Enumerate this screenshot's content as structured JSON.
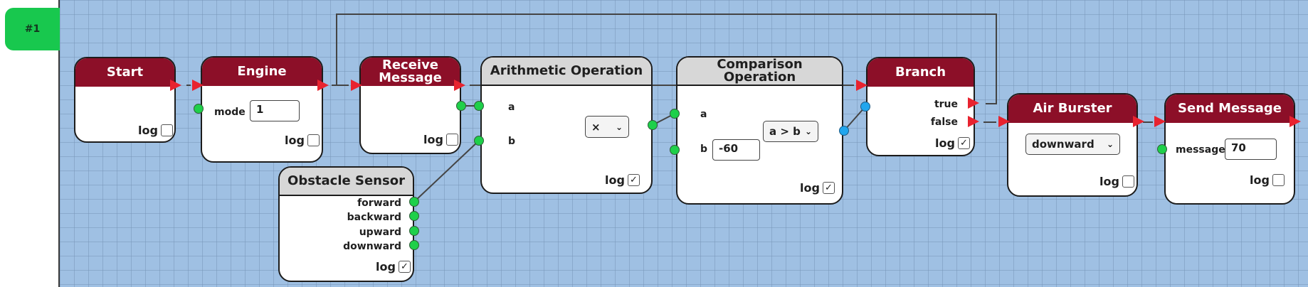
{
  "sidebar": {
    "tab_label": "#1"
  },
  "nodes": {
    "start": {
      "title": "Start",
      "log_label": "log",
      "log_checked": ""
    },
    "engine": {
      "title": "Engine",
      "mode_label": "mode",
      "mode_value": "1",
      "log_label": "log",
      "log_checked": ""
    },
    "receive": {
      "title_line1": "Receive",
      "title_line2": "Message",
      "log_label": "log",
      "log_checked": ""
    },
    "sensor": {
      "title": "Obstacle Sensor",
      "outputs": [
        "forward",
        "backward",
        "upward",
        "downward"
      ],
      "log_label": "log",
      "log_checked": "✓"
    },
    "arith": {
      "title": "Arithmetic Operation",
      "a_label": "a",
      "b_label": "b",
      "operator": "×",
      "log_label": "log",
      "log_checked": "✓"
    },
    "compare": {
      "title_line1": "Comparison",
      "title_line2": "Operation",
      "a_label": "a",
      "b_label": "b",
      "b_value": "-60",
      "operator": "a > b",
      "log_label": "log",
      "log_checked": "✓"
    },
    "branch": {
      "title": "Branch",
      "true_label": "true",
      "false_label": "false",
      "log_label": "log",
      "log_checked": "✓"
    },
    "burster": {
      "title": "Air Burster",
      "direction": "downward",
      "log_label": "log",
      "log_checked": ""
    },
    "send": {
      "title": "Send Message",
      "message_label": "message",
      "message_value": "70",
      "log_label": "log",
      "log_checked": ""
    }
  },
  "colors": {
    "header_red": "#8c0f28",
    "header_gray": "#d7d7d7",
    "canvas": "#9fc0e3",
    "flow_arrow": "#e8232f",
    "port_green": "#1ed04a",
    "port_blue": "#21a6ee",
    "tab_green": "#18c84e"
  }
}
